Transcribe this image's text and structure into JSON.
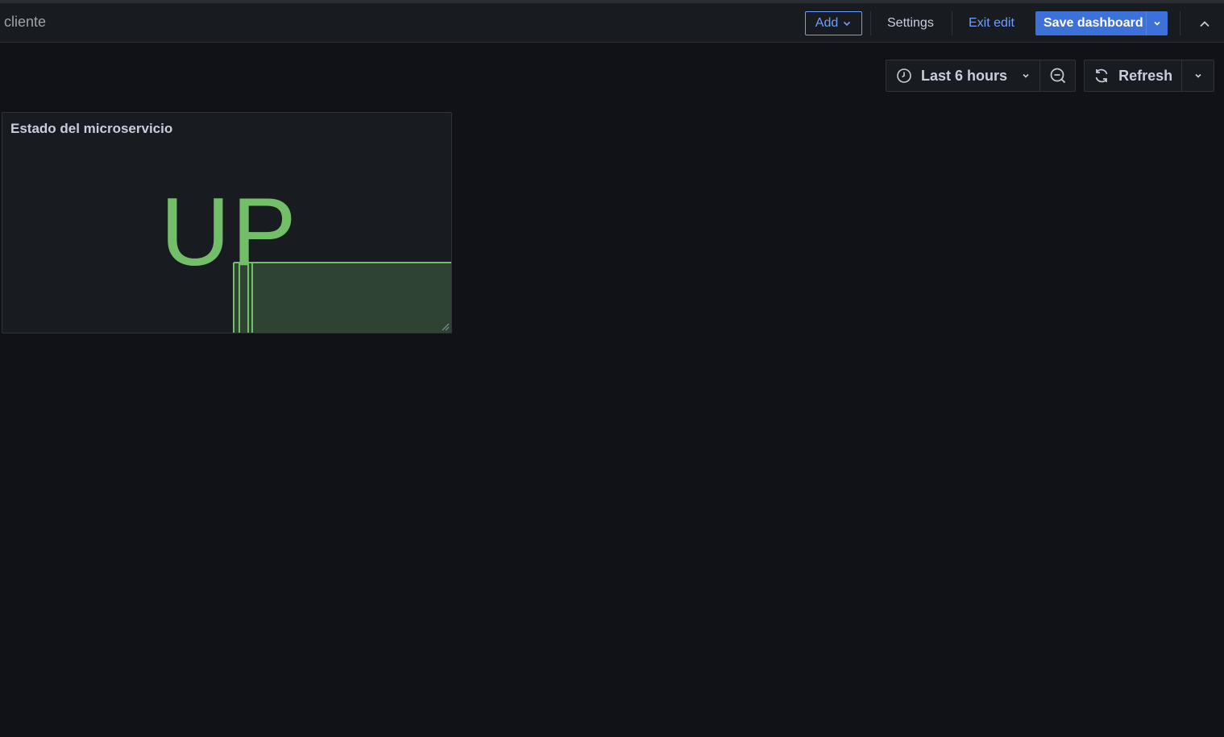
{
  "header": {
    "breadcrumb_visible": "o cliente",
    "add_label": "Add",
    "settings_label": "Settings",
    "exit_edit_label": "Exit edit",
    "save_label": "Save dashboard"
  },
  "toolbar": {
    "time_range": "Last 6 hours",
    "refresh_label": "Refresh"
  },
  "panel": {
    "title": "Estado del microservicio",
    "value": "UP",
    "value_color": "#73bf69"
  },
  "colors": {
    "background": "#111217",
    "surface": "#181b1f",
    "accent": "#3d71d9",
    "link": "#6e9fff",
    "ok_green": "#73bf69"
  },
  "icons": {
    "add_caret": "chevron-down-icon",
    "save_caret": "chevron-down-icon",
    "collapse": "chevron-up-icon",
    "time": "clock-icon",
    "zoom_out": "zoom-out-icon",
    "refresh": "refresh-icon",
    "refresh_caret": "chevron-down-icon"
  }
}
